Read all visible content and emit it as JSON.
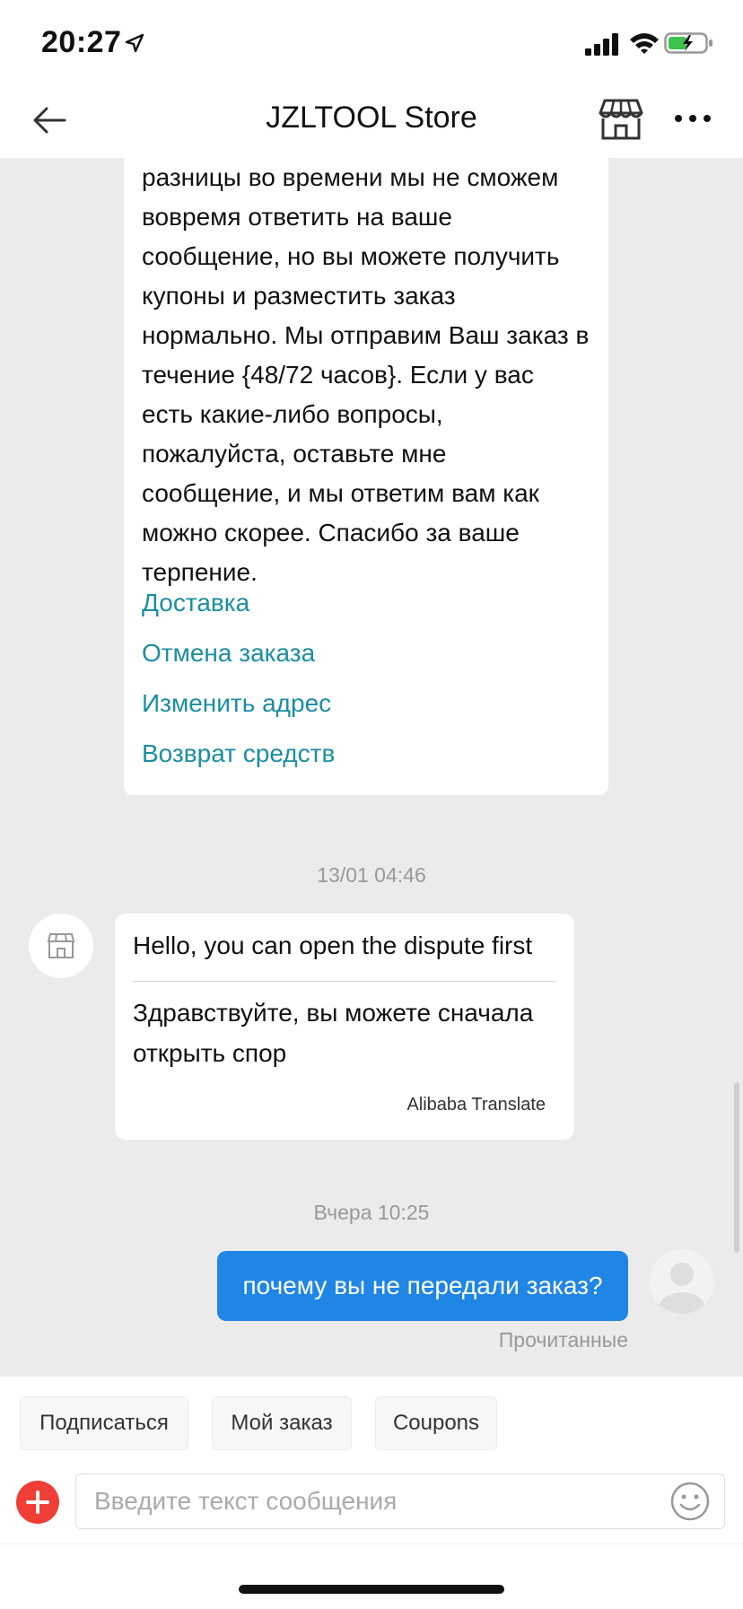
{
  "status_bar": {
    "time": "20:27"
  },
  "header": {
    "title": "JZLTOOL Store"
  },
  "chat": {
    "auto_reply_text": "разницы во времени мы не сможем вовремя ответить на ваше сообщение, но вы можете получить купоны и разместить заказ нормально. Мы отправим Ваш заказ в течение {48/72 часов}. Если у вас есть какие-либо вопросы, пожалуйста, оставьте мне сообщение, и мы ответим вам как можно скорее. Спасибо за ваше терпение.",
    "quick_links": [
      "Доставка",
      "Отмена заказа",
      "Изменить адрес",
      "Возврат средств"
    ],
    "timestamp_1": "13/01 04:46",
    "store_message": {
      "original": "Hello, you can open the dispute first",
      "translation": "Здравствуйте, вы можете сначала открыть спор",
      "provider": "Alibaba Translate"
    },
    "timestamp_2": "Вчера 10:25",
    "user_message": "почему вы не передали заказ?",
    "read_status": "Прочитанные"
  },
  "quick_actions": [
    "Подписаться",
    "Мой заказ",
    "Coupons"
  ],
  "input": {
    "placeholder": "Введите текст сообщения",
    "value": ""
  }
}
